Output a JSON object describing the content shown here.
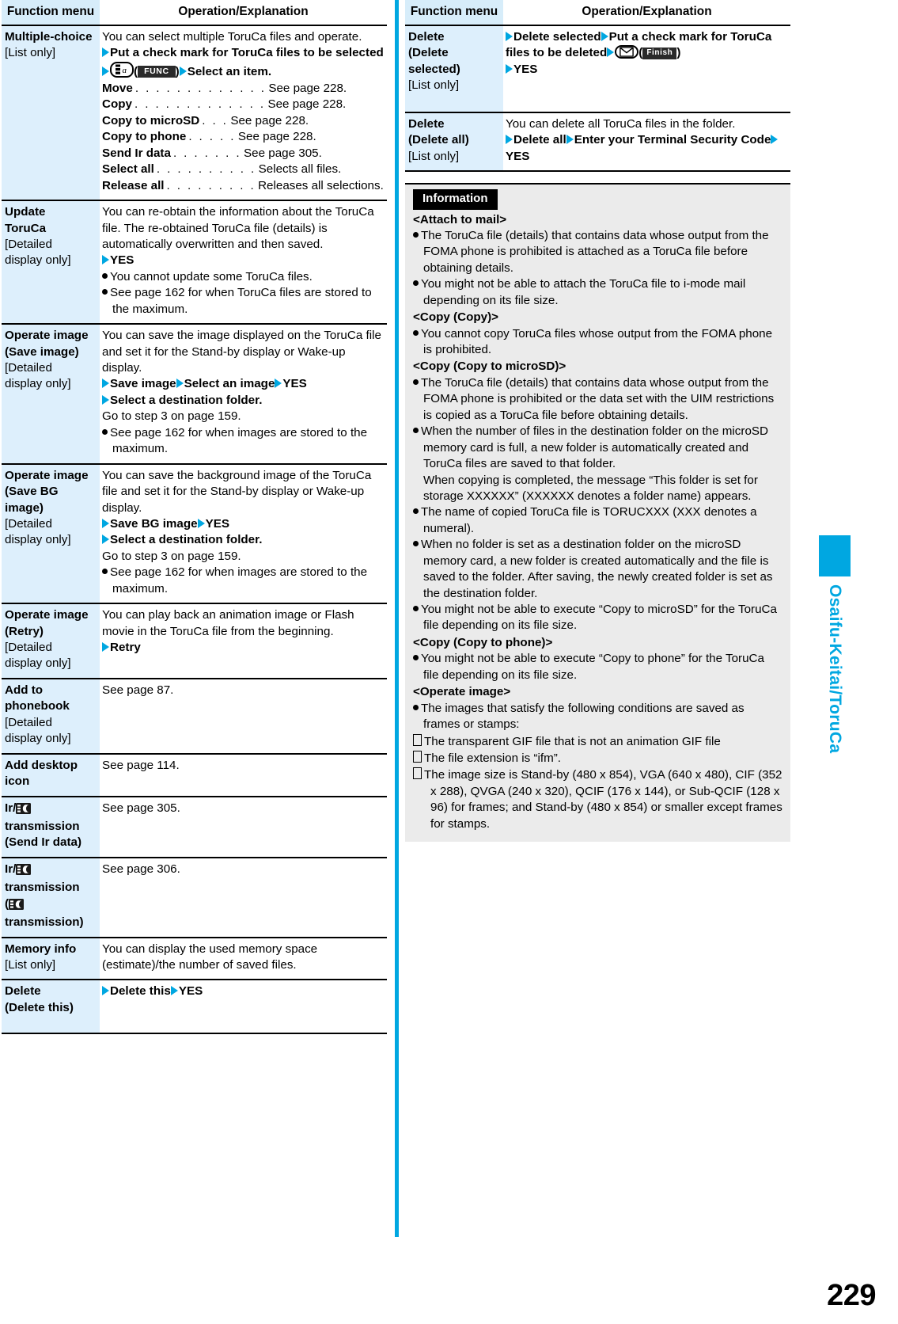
{
  "page": {
    "number": "229",
    "side_tab_label": "Osaifu-Keitai/ToruCa"
  },
  "left_table": {
    "headers": {
      "menu": "Function menu",
      "operation": "Operation/Explanation"
    },
    "rows": [
      {
        "menu_title": "Multiple-choice",
        "menu_sub": "[List only]",
        "intro": "You can select multiple ToruCa files and operate.",
        "step_line1_a": "Put a check mark for ToruCa files to be",
        "step_line2_a": "selected",
        "step_key_label": "FUNC",
        "step_line2_b": "Select an item.",
        "leaders": [
          {
            "label": "Move",
            "dots": ". . . . . . . . . . . . .",
            "value": "See page 228."
          },
          {
            "label": "Copy",
            "dots": ". . . . . . . . . . . . .",
            "value": "See page 228."
          },
          {
            "label": "Copy to microSD",
            "dots": ". . .",
            "value": "See page 228."
          },
          {
            "label": "Copy to phone",
            "dots": ". . . . .",
            "value": "See page 228."
          },
          {
            "label": "Send Ir data",
            "dots": ". . . . . . .",
            "value": "See page 305."
          },
          {
            "label": "Select all",
            "dots": ". . . . . . . . . .",
            "value": "Selects all files."
          },
          {
            "label": "Release all",
            "dots": ". . . . . . . . .",
            "value": "Releases all selections."
          }
        ]
      },
      {
        "menu_title_l1": "Update",
        "menu_title_l2": "ToruCa",
        "menu_sub_l1": "[Detailed",
        "menu_sub_l2": "display only]",
        "body1": "You can re-obtain the information about the ToruCa file. The re-obtained ToruCa file (details) is automatically overwritten and then saved.",
        "step_yes": "YES",
        "note1": "You cannot update some ToruCa files.",
        "note2": "See page 162 for when ToruCa files are stored to the maximum."
      },
      {
        "menu_title_l1": "Operate image",
        "menu_title_l2": "(Save image)",
        "menu_sub_l1": "[Detailed",
        "menu_sub_l2": "display only]",
        "body1": "You can save the image displayed on the ToruCa file and set it for the Stand-by display or Wake-up display.",
        "step_a": "Save image",
        "step_b": "Select an image",
        "step_c": "YES",
        "step_d": "Select a destination folder.",
        "goto": "Go to step 3 on page 159.",
        "note1": "See page 162 for when images are stored to the maximum."
      },
      {
        "menu_title_l1": "Operate image",
        "menu_title_l2": "(Save BG",
        "menu_title_l3": "image)",
        "menu_sub_l1": "[Detailed",
        "menu_sub_l2": "display only]",
        "body1": "You can save the background image of the ToruCa file and set it for the Stand-by display or Wake-up display.",
        "step_a": "Save BG image",
        "step_b": "YES",
        "step_d": "Select a destination folder.",
        "goto": "Go to step 3 on page 159.",
        "note1": "See page 162 for when images are stored to the maximum."
      },
      {
        "menu_title_l1": "Operate image",
        "menu_title_l2": "(Retry)",
        "menu_sub_l1": "[Detailed",
        "menu_sub_l2": "display only]",
        "body1": "You can play back an animation image or Flash movie in the ToruCa file from the beginning.",
        "step_a": "Retry"
      },
      {
        "menu_title_l1": "Add to",
        "menu_title_l2": "phonebook",
        "menu_sub_l1": "[Detailed",
        "menu_sub_l2": "display only]",
        "body1": "See page 87."
      },
      {
        "menu_title_l1": "Add desktop",
        "menu_title_l2": "icon",
        "body1": "See page 114."
      },
      {
        "menu_title_l1": "Ir/",
        "menu_title_l2": "transmission",
        "menu_title_l3": "(Send Ir data)",
        "body1": "See page 305."
      },
      {
        "menu_title_l1": "Ir/",
        "menu_title_l2": "transmission",
        "menu_title_l3": "(",
        "menu_title_l4": "transmission)",
        "body1": "See page 306."
      },
      {
        "menu_title_l1": "Memory info",
        "menu_sub_l1": "[List only]",
        "body1": "You can display the used memory space (estimate)/the number of saved files."
      },
      {
        "menu_title_l1": "Delete",
        "menu_title_l2": "(Delete this)",
        "step_a": "Delete this",
        "step_b": "YES"
      }
    ]
  },
  "right_table": {
    "headers": {
      "menu": "Function menu",
      "operation": "Operation/Explanation"
    },
    "rows": [
      {
        "menu_title_l1": "Delete",
        "menu_title_l2": "(Delete",
        "menu_title_l3": "selected)",
        "menu_sub_l1": "[List only]",
        "step_a": "Delete selected",
        "step_b": "Put a check mark for",
        "step_c": "ToruCa files to be deleted",
        "softkey_label": "Finish",
        "step_d": "YES"
      },
      {
        "menu_title_l1": "Delete",
        "menu_title_l2": "(Delete all)",
        "menu_sub_l1": "[List only]",
        "body1": "You can delete all ToruCa files in the folder.",
        "step_a": "Delete all",
        "step_b": "Enter your Terminal Security",
        "step_c": "Code",
        "step_d": "YES"
      }
    ]
  },
  "information": {
    "title": "Information",
    "sections": [
      {
        "heading": "<Attach to mail>",
        "items": [
          "The ToruCa file (details) that contains data whose output from the FOMA phone is prohibited is attached as a ToruCa file before obtaining details.",
          "You might not be able to attach the ToruCa file to i-mode mail depending on its file size."
        ]
      },
      {
        "heading": "<Copy (Copy)>",
        "items": [
          "You cannot copy ToruCa files whose output from the FOMA phone is prohibited."
        ]
      },
      {
        "heading": "<Copy (Copy to microSD)>",
        "items": [
          "The ToruCa file (details) that contains data whose output from the FOMA phone is prohibited or the data set with the UIM restrictions is copied as a ToruCa file before obtaining details.",
          "When the number of files in the destination folder on the microSD memory card is full, a new folder is automatically created and ToruCa files are saved to that folder.",
          "The name of copied ToruCa file is TORUCXXX (XXX denotes a numeral).",
          "When no folder is set as a destination folder on the microSD memory card, a new folder is created automatically and the file is saved to the folder. After saving, the newly created folder is set as the destination folder.",
          "You might not be able to execute “Copy to microSD” for the ToruCa file depending on its file size."
        ],
        "item2_continuation": "When copying is completed, the message “This folder is set for storage XXXXXX” (XXXXXX denotes a folder name) appears."
      },
      {
        "heading": "<Copy (Copy to phone)>",
        "items": [
          "You might not be able to execute “Copy to phone” for the ToruCa file depending on its file size."
        ]
      },
      {
        "heading": "<Operate image>",
        "items": [
          "The images that satisfy the following conditions are saved as frames or stamps:"
        ],
        "sub_items": [
          "The transparent GIF file that is not an animation GIF file",
          "The file extension is “ifm”.",
          "The image size is Stand-by (480 x 854), VGA (640 x 480), CIF (352 x 288), QVGA (240 x 320), QCIF (176 x 144), or Sub-QCIF (128 x 96) for frames; and Stand-by (480 x 854) or smaller except frames for stamps."
        ]
      }
    ]
  },
  "colors": {
    "accent": "#00a7e1",
    "menu_cell_bg": "#ddeffc",
    "header_bg": "#d7edfa",
    "info_bg": "#ebebeb"
  }
}
